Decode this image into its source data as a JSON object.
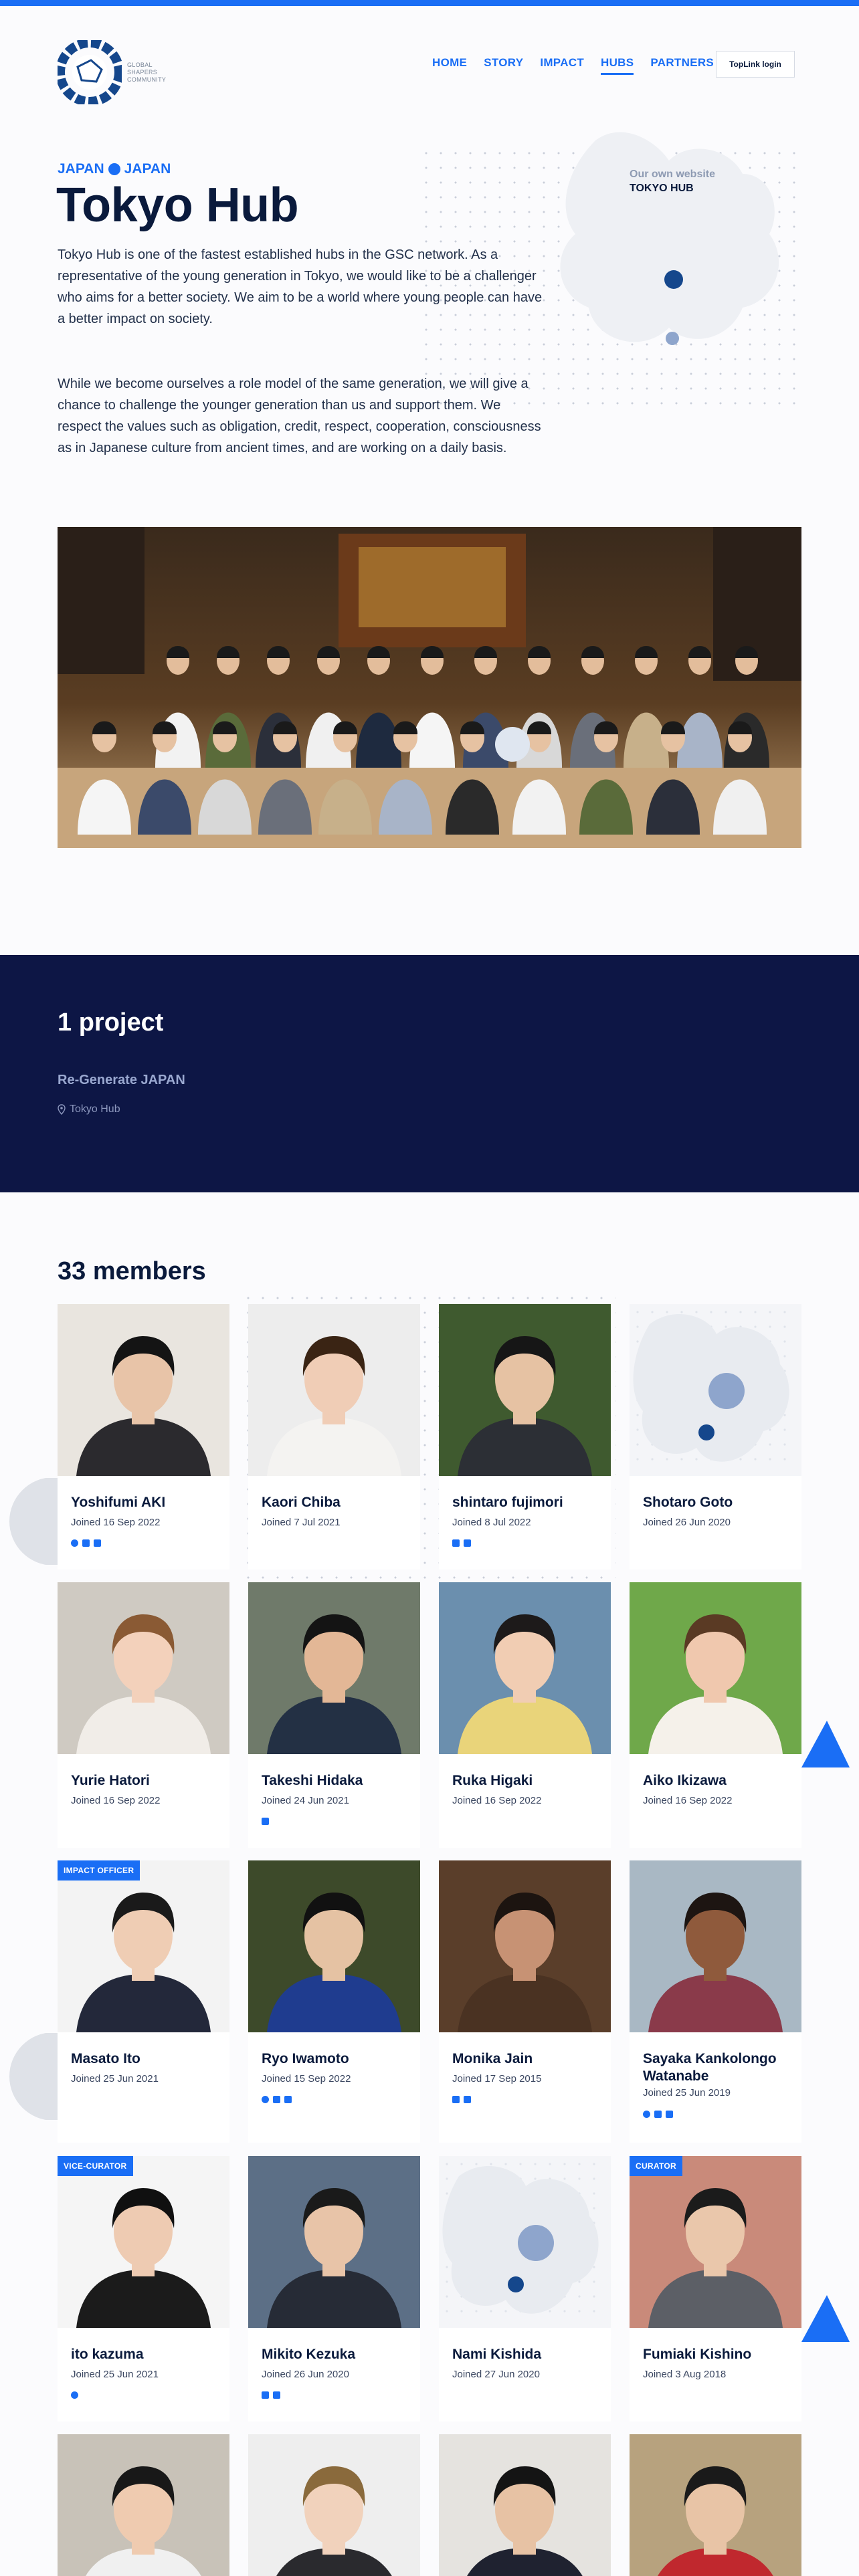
{
  "header": {
    "logo_text": [
      "GLOBAL",
      "SHAPERS",
      "COMMUNITY"
    ],
    "nav": [
      "HOME",
      "STORY",
      "IMPACT",
      "HUBS",
      "PARTNERS"
    ],
    "active_nav": "HUBS",
    "login_label": "TopLink login"
  },
  "hero": {
    "region": "JAPAN",
    "country": "JAPAN",
    "title": "Tokyo Hub",
    "paragraph1": "Tokyo Hub is one of the fastest established hubs in the GSC network. As a representative of the young generation in Tokyo, we would like to be a challenger who aims for a better society. We aim to be a world where young people can have a better impact on society.",
    "paragraph2": "While we become ourselves a role model of the same generation, we will give a chance to challenge the younger generation than us and support them. We respect the values such as obligation, credit, respect, cooperation, consciousness as in Japanese culture from ancient times, and are working on a daily basis.",
    "website_label": "Our own website",
    "website_name": "TOKYO HUB"
  },
  "projects": {
    "count_label": "1 project",
    "items": [
      {
        "name": "Re-Generate JAPAN",
        "location": "Tokyo Hub"
      }
    ]
  },
  "members": {
    "title": "33 members",
    "list": [
      {
        "name": "Yoshifumi AKI",
        "joined": "Joined 16 Sep 2022",
        "social": [
          "twitter",
          "linkedin",
          "facebook"
        ],
        "badge": "",
        "photo": "man-cafe"
      },
      {
        "name": "Kaori Chiba",
        "joined": "Joined 7 Jul 2021",
        "social": [],
        "badge": "",
        "photo": "woman-white"
      },
      {
        "name": "shintaro fujimori",
        "joined": "Joined 8 Jul 2022",
        "social": [
          "linkedin",
          "facebook"
        ],
        "badge": "",
        "photo": "man-glasses-plant"
      },
      {
        "name": "Shotaro Goto",
        "joined": "Joined 26 Jun 2020",
        "social": [],
        "badge": "",
        "photo": "placeholder"
      },
      {
        "name": "Yurie Hatori",
        "joined": "Joined 16 Sep 2022",
        "social": [],
        "badge": "",
        "photo": "woman-cat"
      },
      {
        "name": "Takeshi Hidaka",
        "joined": "Joined 24 Jun 2021",
        "social": [
          "facebook"
        ],
        "badge": "",
        "photo": "man-navy"
      },
      {
        "name": "Ruka Higaki",
        "joined": "Joined 16 Sep 2022",
        "social": [],
        "badge": "",
        "photo": "woman-kimono"
      },
      {
        "name": "Aiko Ikizawa",
        "joined": "Joined 16 Sep 2022",
        "social": [],
        "badge": "",
        "photo": "woman-grass"
      },
      {
        "name": "Masato Ito",
        "joined": "Joined 25 Jun 2021",
        "social": [],
        "badge": "IMPACT OFFICER",
        "photo": "man-suit"
      },
      {
        "name": "Ryo Iwamoto",
        "joined": "Joined 15 Sep 2022",
        "social": [
          "twitter",
          "linkedin",
          "facebook"
        ],
        "badge": "",
        "photo": "man-blue-kimono"
      },
      {
        "name": "Monika Jain",
        "joined": "Joined 17 Sep 2015",
        "social": [
          "linkedin",
          "facebook"
        ],
        "badge": "",
        "photo": "woman-smile"
      },
      {
        "name": "Sayaka Kankolongo Watanabe",
        "joined": "Joined 25 Jun 2019",
        "social": [
          "twitter",
          "linkedin",
          "facebook"
        ],
        "badge": "",
        "photo": "woman-laugh"
      },
      {
        "name": "ito kazuma",
        "joined": "Joined 25 Jun 2021",
        "social": [
          "twitter"
        ],
        "badge": "VICE-CURATOR",
        "photo": "man-black"
      },
      {
        "name": "Mikito Kezuka",
        "joined": "Joined 26 Jun 2020",
        "social": [
          "linkedin",
          "facebook"
        ],
        "badge": "",
        "photo": "man-glasses-suit"
      },
      {
        "name": "Nami Kishida",
        "joined": "Joined 27 Jun 2020",
        "social": [],
        "badge": "",
        "photo": "placeholder"
      },
      {
        "name": "Fumiaki Kishino",
        "joined": "Joined 3 Aug 2018",
        "social": [],
        "badge": "CURATOR",
        "photo": "man-glasses-gray"
      },
      {
        "name": "",
        "joined": "",
        "social": [],
        "badge": "",
        "photo": "man-bookshelf"
      },
      {
        "name": "",
        "joined": "",
        "social": [],
        "badge": "",
        "photo": "man-blond"
      },
      {
        "name": "",
        "joined": "",
        "social": [],
        "badge": "",
        "photo": "man-suit-dark"
      },
      {
        "name": "",
        "joined": "",
        "social": [],
        "badge": "",
        "photo": "man-red-sash"
      }
    ]
  },
  "colors": {
    "accent": "#1a6ef5",
    "navy": "#0d1645",
    "text": "#0a1a3c",
    "placeholder_bg": "#eef0f4",
    "placeholder_dot": "#8ea5cc",
    "placeholder_dot_dark": "#15478c"
  }
}
